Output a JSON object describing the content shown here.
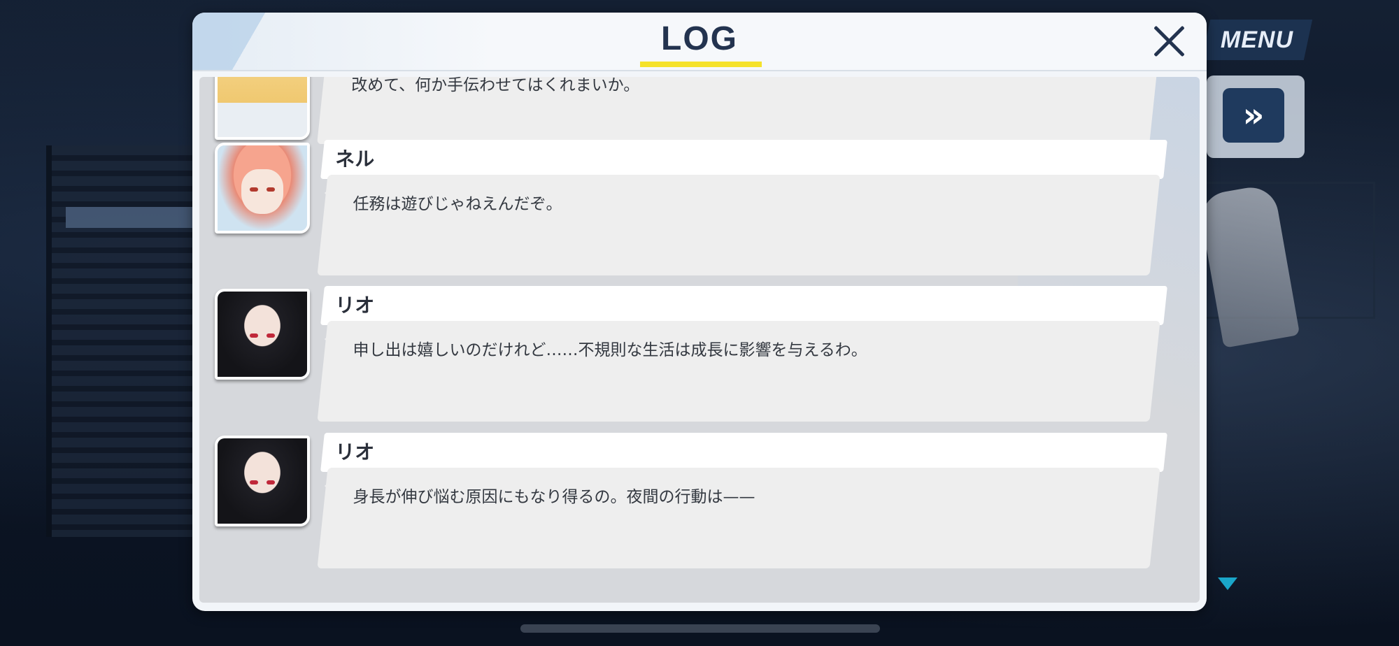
{
  "background": {
    "menu_label": "MENU"
  },
  "dialog": {
    "title": "LOG",
    "accent_color": "#f5e22a"
  },
  "log": [
    {
      "speaker": "",
      "text": "改めて、何か手伝わせてはくれまいか。",
      "avatar": "blonde-character-portrait"
    },
    {
      "speaker": "ネル",
      "text": "任務は遊びじゃねえんだぞ。",
      "avatar": "neru-portrait"
    },
    {
      "speaker": "リオ",
      "text": "申し出は嬉しいのだけれど……不規則な生活は成長に影響を与えるわ。",
      "avatar": "rio-portrait"
    },
    {
      "speaker": "リオ",
      "text": "身長が伸び悩む原因にもなり得るの。夜間の行動は——",
      "avatar": "rio-portrait"
    }
  ]
}
